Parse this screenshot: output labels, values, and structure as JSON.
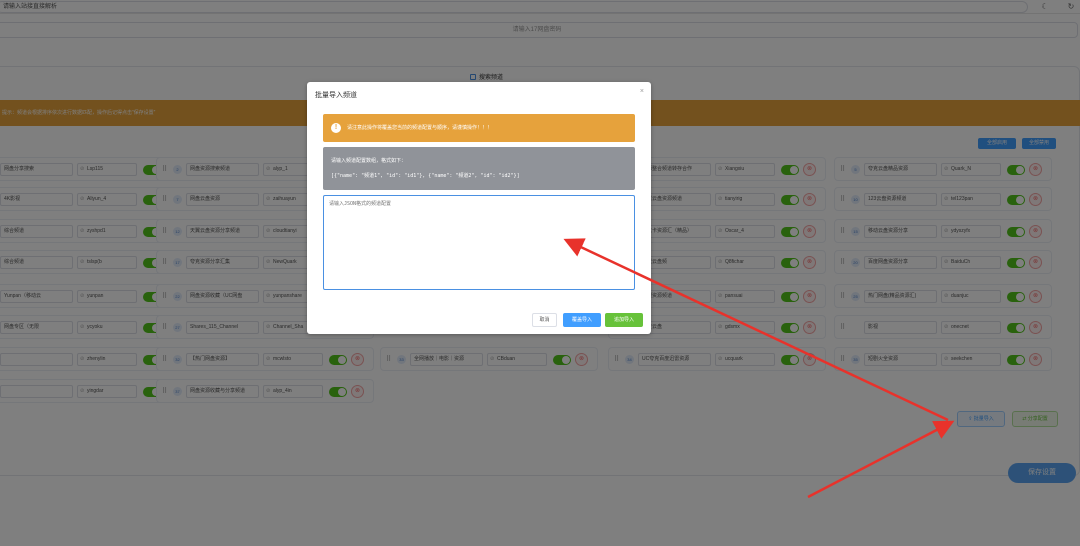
{
  "topbar": {
    "url_value": "请输入站接直接解析",
    "theme_icon": "moon-icon",
    "refresh_icon": "refresh-icon"
  },
  "search": {
    "placeholder": "请输入17网盘密码"
  },
  "panel": {
    "title": "搜索频道",
    "warning": "提示：频道会根据排序依次进行数据匹配，操作后记得点击“保存设置”",
    "enable_all": "全部启用",
    "disable_all": "全部禁用"
  },
  "cards": [
    {
      "num": "",
      "name": "网盘分享搜索",
      "id": "Lsp115"
    },
    {
      "num": "",
      "name": "4K影视",
      "id": "Aliyun_4"
    },
    {
      "num": "",
      "name": "综合频道",
      "id": "zyshpd1"
    },
    {
      "num": "",
      "name": "综合频道",
      "id": "tslsp(b"
    },
    {
      "num": "",
      "name": "Yunpan（移动云",
      "id": "yunpan"
    },
    {
      "num": "",
      "name": "网盘专区（无限",
      "id": "ycyoku"
    },
    {
      "num": "",
      "name": "",
      "id": "zhenylin"
    },
    {
      "num": "",
      "name": "",
      "id": "yingdar"
    },
    {
      "num": "2",
      "name": "网盘资源搜索频道",
      "id": "alyp_1"
    },
    {
      "num": "7",
      "name": "网盘云盘资源",
      "id": "zaihuayun"
    },
    {
      "num": "12",
      "name": "天翼云盘资源分享频道",
      "id": "cloudtianyi"
    },
    {
      "num": "17",
      "name": "夸克资源分享汇集",
      "id": "NewQuark"
    },
    {
      "num": "22",
      "name": "网盘资源收藏（UC网盘",
      "id": "yunpanshare"
    },
    {
      "num": "27",
      "name": "Shares_115_Channel",
      "id": "Channel_Sha"
    },
    {
      "num": "32",
      "name": "【热门网盘资源】",
      "id": "mcwlsto"
    },
    {
      "num": "37",
      "name": "网盘资源收藏与分享频道",
      "id": "alyp_4in"
    },
    {
      "num": "",
      "name": "全网播放｜电影｜资源",
      "id": "CBduan",
      "numtext": "33"
    },
    {
      "num": "",
      "name": "资源整合频道转存合作",
      "id": "Xiangxiu"
    },
    {
      "num": "",
      "name": "天翼云盘资源频道",
      "id": "tianyirig"
    },
    {
      "num": "",
      "name": "夸克卡资源汇（精品）",
      "id": "Oscar_4"
    },
    {
      "num": "",
      "name": "阿里云盘频",
      "id": "Q8fichar"
    },
    {
      "num": "",
      "name": "影视资源频道",
      "id": "pansuai"
    },
    {
      "num": "",
      "name": "百度云盘",
      "id": "gdsmx"
    },
    {
      "num": "34",
      "name": "UC夸克百度迅雷资源",
      "id": "ucquark"
    },
    {
      "num": "5",
      "name": "夸克云盘精品资源",
      "id": "Quark_N"
    },
    {
      "num": "10",
      "name": "123云盘资源频道",
      "id": "tel123pan"
    },
    {
      "num": "15",
      "name": "移动云盘资源分享",
      "id": "ydyszyfx"
    },
    {
      "num": "20",
      "name": "百度网盘资源分享",
      "id": "BaiduCh"
    },
    {
      "num": "25",
      "name": "热门网盘(精品资源汇)",
      "id": "duanjuc"
    },
    {
      "num": "",
      "name": "影视",
      "id": "onecnet"
    },
    {
      "num": "35",
      "name": "短剧火全资源",
      "id": "seekchen"
    }
  ],
  "bottom": {
    "batch_import": "批量导入",
    "batch_export": "分享配置",
    "save": "保存设置"
  },
  "modal": {
    "title": "批量导入频道",
    "warning": "请注意此操作将覆盖您当前的频道配置与顺序，请谨慎操作！！！",
    "info_line1": "请输入频道配置数组，格式如下：",
    "info_line2": "[{\"name\": \"频道1\", \"id\": \"id1\"}, {\"name\": \"频道2\", \"id\": \"id2\"}]",
    "textarea_placeholder": "请输入JSON格式的频道配置",
    "cancel": "取消",
    "overwrite": "覆盖导入",
    "append": "追加导入"
  },
  "colors": {
    "accent": "#409eff",
    "warning": "#e6a23c",
    "success": "#67c23a",
    "info": "#909399",
    "danger": "#f56c6c",
    "annotation_arrow": "#e8322b"
  }
}
